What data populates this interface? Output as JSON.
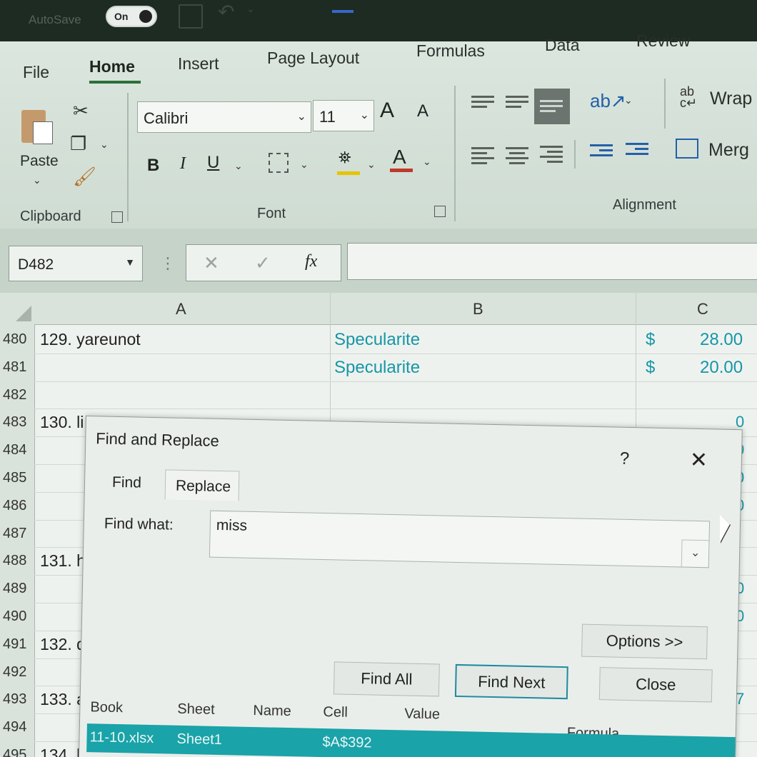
{
  "titlebar": {
    "autosave_label": "AutoSave",
    "autosave_state": "On"
  },
  "ribbon": {
    "tabs": [
      "File",
      "Home",
      "Insert",
      "Page Layout",
      "Formulas",
      "Data",
      "Review"
    ],
    "active_tab": "Home",
    "clipboard": {
      "paste_label": "Paste",
      "group_label": "Clipboard"
    },
    "font": {
      "family": "Calibri",
      "size": "11",
      "group_label": "Font",
      "bold": "B",
      "italic": "I",
      "underline": "U",
      "grow": "A",
      "shrink": "A",
      "color_letter": "A"
    },
    "alignment": {
      "group_label": "Alignment",
      "wrap_label": "Wrap",
      "merge_label": "Merg"
    },
    "colors": {
      "accent": "#2b6f3a",
      "fill": "#e7c300",
      "font_color": "#c0392b"
    }
  },
  "formula_bar": {
    "name_box": "D482",
    "cancel": "✕",
    "enter": "✓",
    "fx": "fx",
    "value": ""
  },
  "grid": {
    "columns": [
      "A",
      "B",
      "C"
    ],
    "rows": [
      {
        "num": "480",
        "a": "129. yareunot",
        "b": "Specularite",
        "c_sym": "$",
        "c_val": "28.00"
      },
      {
        "num": "481",
        "a": "",
        "b": "Specularite",
        "c_sym": "$",
        "c_val": "20.00"
      },
      {
        "num": "482",
        "a": "",
        "b": "",
        "c_sym": "",
        "c_val": ""
      },
      {
        "num": "483",
        "a": "130. li",
        "b": "",
        "c_sym": "",
        "c_val": ""
      },
      {
        "num": "484",
        "a": "",
        "b": "",
        "c_sym": "",
        "c_val": ""
      },
      {
        "num": "485",
        "a": "",
        "b": "",
        "c_sym": "",
        "c_val": ""
      },
      {
        "num": "486",
        "a": "",
        "b": "",
        "c_sym": "",
        "c_val": ""
      },
      {
        "num": "487",
        "a": "",
        "b": "",
        "c_sym": "",
        "c_val": ""
      },
      {
        "num": "488",
        "a": "131. h",
        "b": "",
        "c_sym": "",
        "c_val": ""
      },
      {
        "num": "489",
        "a": "",
        "b": "",
        "c_sym": "",
        "c_val": ""
      },
      {
        "num": "490",
        "a": "",
        "b": "",
        "c_sym": "",
        "c_val": ""
      },
      {
        "num": "491",
        "a": "132. d",
        "b": "",
        "c_sym": "",
        "c_val": ""
      },
      {
        "num": "492",
        "a": "",
        "b": "",
        "c_sym": "",
        "c_val": ""
      },
      {
        "num": "493",
        "a": "133. a",
        "b": "",
        "c_sym": "",
        "c_val": ""
      },
      {
        "num": "494",
        "a": "",
        "b": "",
        "c_sym": "",
        "c_val": ""
      },
      {
        "num": "495",
        "a": "134. h",
        "b": "",
        "c_sym": "",
        "c_val": ""
      }
    ],
    "edge_values": [
      "0",
      "0",
      "0",
      "0",
      "0",
      "0",
      "7"
    ]
  },
  "dialog": {
    "title": "Find and Replace",
    "help": "?",
    "close": "✕",
    "tabs": {
      "find": "Find",
      "replace": "Replace"
    },
    "find_what_label": "Find what:",
    "find_what_value": "miss",
    "buttons": {
      "options": "Options >>",
      "find_all": "Find All",
      "find_next": "Find Next",
      "close": "Close"
    },
    "results_columns": [
      "Book",
      "Sheet",
      "Name",
      "Cell",
      "Value",
      "Formula"
    ],
    "result": {
      "book": "11-10.xlsx",
      "sheet": "Sheet1",
      "cell": "$A$392"
    },
    "colors": {
      "result_highlight": "#1aa3a8",
      "default_button_border": "#1f8aa0"
    }
  }
}
